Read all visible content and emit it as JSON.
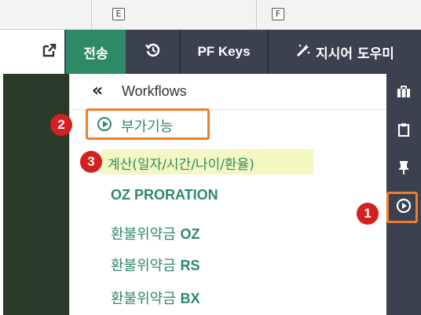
{
  "column_headers": [
    {
      "key": "E"
    },
    {
      "key": "F"
    }
  ],
  "toolbar": {
    "send_label": "전송",
    "pf_keys_label": "PF Keys",
    "directive_label": "지시어 도우미"
  },
  "workflows": {
    "title": "Workflows",
    "submenu_label": "부가기능",
    "items": [
      {
        "label": "계산(일자/시간/나이/환율)"
      },
      {
        "label": "OZ PRORATION"
      },
      {
        "label_kr": "환불위약금",
        "label_code": "OZ"
      },
      {
        "label_kr": "환불위약금",
        "label_code": "RS"
      },
      {
        "label_kr": "환불위약금",
        "label_code": "BX"
      }
    ]
  },
  "badges": [
    "1",
    "2",
    "3"
  ],
  "colors": {
    "accent_green": "#2e8a66",
    "toolbar_bg": "#3c4150",
    "highlight_orange": "#ef7d2a",
    "badge_red": "#d62020",
    "row_highlight": "#f4f7c2"
  },
  "icons": {
    "toolbar": [
      "external-link-icon",
      "history-icon",
      "magic-wand-icon"
    ],
    "rail": [
      "briefcase-icon",
      "clipboard-icon",
      "pin-icon",
      "play-circle-icon"
    ]
  }
}
